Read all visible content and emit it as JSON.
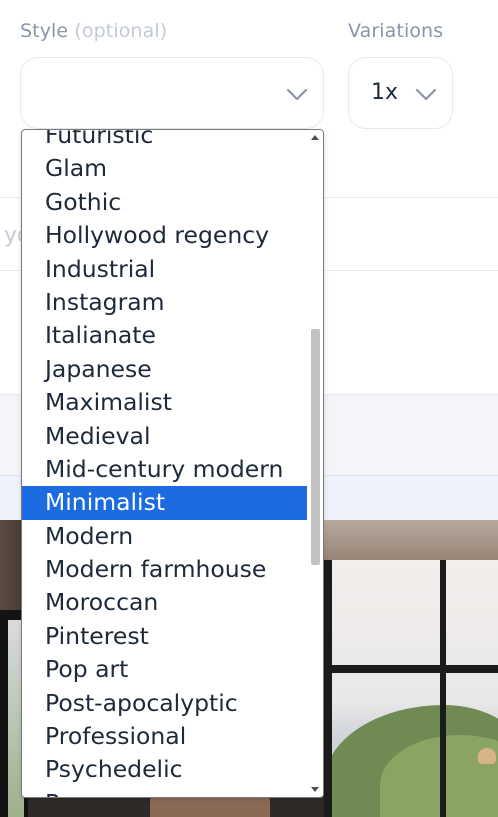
{
  "form": {
    "style_label": "Style",
    "style_optional": "(optional)",
    "style_value": "",
    "variations_label": "Variations",
    "variations_value": "1x"
  },
  "style_dropdown": {
    "is_open": true,
    "selected": "Minimalist",
    "options": [
      "Futuristic",
      "Glam",
      "Gothic",
      "Hollywood regency",
      "Industrial",
      "Instagram",
      "Italianate",
      "Japanese",
      "Maximalist",
      "Medieval",
      "Mid-century modern",
      "Minimalist",
      "Modern",
      "Modern farmhouse",
      "Moroccan",
      "Pinterest",
      "Pop art",
      "Post-apocalyptic",
      "Professional",
      "Psychedelic",
      "Rococo"
    ]
  },
  "background": {
    "prompt_fragment": "yo"
  },
  "colors": {
    "selected_bg": "#1c6be0",
    "label_color": "#8a96a6",
    "text_color": "#1e2a3a"
  },
  "icons": {
    "select_chevron": "chevron-down-icon",
    "scroll_up": "scroll-up-arrow-icon",
    "scroll_down": "scroll-down-arrow-icon"
  }
}
